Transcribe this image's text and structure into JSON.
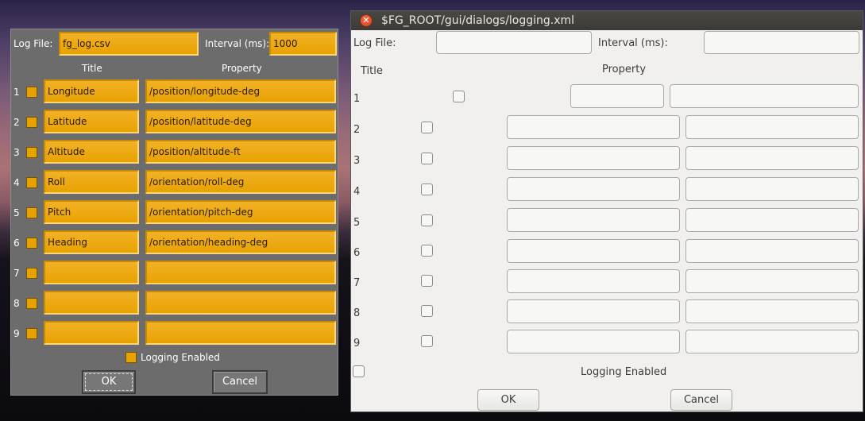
{
  "pui_dialog": {
    "log_file_label": "Log File:",
    "log_file_value": "fg_log.csv",
    "interval_label": "Interval (ms):",
    "interval_value": "1000",
    "title_header": "Title",
    "property_header": "Property",
    "rows": [
      {
        "n": "1",
        "title": "Longitude",
        "property": "/position/longitude-deg"
      },
      {
        "n": "2",
        "title": "Latitude",
        "property": "/position/latitude-deg"
      },
      {
        "n": "3",
        "title": "Altitude",
        "property": "/position/altitude-ft"
      },
      {
        "n": "4",
        "title": "Roll",
        "property": "/orientation/roll-deg"
      },
      {
        "n": "5",
        "title": "Pitch",
        "property": "/orientation/pitch-deg"
      },
      {
        "n": "6",
        "title": "Heading",
        "property": "/orientation/heading-deg"
      },
      {
        "n": "7",
        "title": "",
        "property": ""
      },
      {
        "n": "8",
        "title": "",
        "property": ""
      },
      {
        "n": "9",
        "title": "",
        "property": ""
      }
    ],
    "logging_enabled_label": "Logging Enabled",
    "ok_label": "OK",
    "cancel_label": "Cancel",
    "colors": {
      "panel": "#6c6c6c",
      "field": "#e8a200",
      "button": "#777777"
    }
  },
  "gtk_dialog": {
    "window_title": "$FG_ROOT/gui/dialogs/logging.xml",
    "close_icon": "close-icon",
    "log_file_label": "Log File:",
    "interval_label": "Interval (ms):",
    "title_header": "Title",
    "property_header": "Property",
    "row_numbers": [
      "1",
      "2",
      "3",
      "4",
      "5",
      "6",
      "7",
      "8",
      "9"
    ],
    "logging_enabled_label": "Logging Enabled",
    "ok_label": "OK",
    "cancel_label": "Cancel",
    "colors": {
      "background": "#f1f0ee",
      "titlebar": "#3b3a36",
      "close": "#e0491f"
    }
  }
}
